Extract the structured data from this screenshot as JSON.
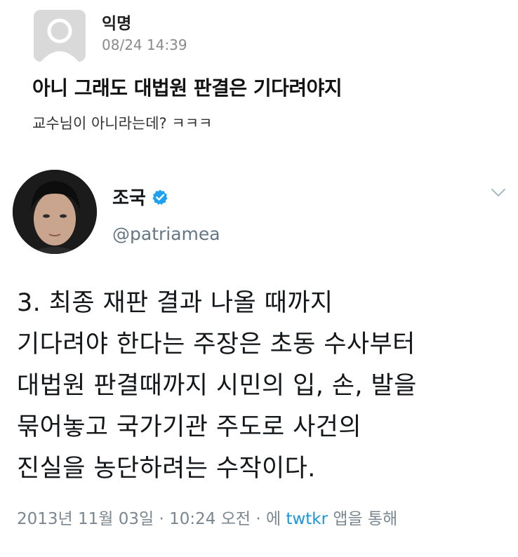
{
  "post": {
    "author": "익명",
    "timestamp": "08/24 14:39",
    "title": "아니 그래도 대법원 판결은 기다려야지",
    "body": "교수님이 아니라는데? ㅋㅋㅋ",
    "avatar_icon": "default-user-icon"
  },
  "tweet": {
    "display_name": "조국",
    "handle": "@patriamea",
    "verified": true,
    "verified_icon": "verified-badge-icon",
    "menu_icon": "chevron-down-icon",
    "text_lines": [
      "3. 최종 재판 결과 나올 때까지",
      "기다려야 한다는 주장은 초동 수사부터",
      "대법원 판결때까지 시민의 입, 손, 발을",
      "묶어놓고 국가기관 주도로 사건의",
      "진실을 농단하려는 수작이다."
    ],
    "meta": {
      "date": "2013년 11월 03일",
      "separator": "·",
      "time": "10:24 오전",
      "via_prefix": "에",
      "app": "twtkr",
      "via_suffix": "앱을 통해"
    }
  },
  "colors": {
    "link": "#1b95e0",
    "verified": "#1da1f2",
    "muted": "#7b8790"
  }
}
